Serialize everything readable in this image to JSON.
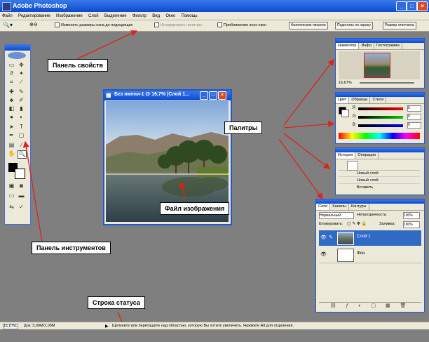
{
  "window": {
    "title": "Adobe Photoshop",
    "min": "_",
    "max": "□",
    "close": "×"
  },
  "menu": [
    "Файл",
    "Редактирование",
    "Изображение",
    "Слой",
    "Выделение",
    "Фильтр",
    "Вид",
    "Окно",
    "Помощь"
  ],
  "options": {
    "check1": "Изменить размеры окна до подходящих",
    "check2": "Игнорировать палитры",
    "check3": "Приближение всех окон",
    "btn1": "Фактические пиксели",
    "btn2": "Подогнать по экрану",
    "btn3": "Размер отпечатка"
  },
  "document": {
    "title": "Без имени-1 @ 16,7% (Слой 1..."
  },
  "navigator": {
    "tabs": [
      "Навигатор",
      "Инфо",
      "Гистограмма"
    ],
    "zoom": "16,67%"
  },
  "color": {
    "tabs": [
      "Цвет",
      "Образцы",
      "Стили"
    ],
    "channels": [
      "R",
      "G",
      "B"
    ],
    "values": [
      "0",
      "0",
      "0"
    ]
  },
  "history": {
    "tabs": [
      "История",
      "Операции"
    ],
    "items": [
      "Новый слой",
      "Новый слой",
      "Вставить"
    ]
  },
  "layers": {
    "tabs": [
      "Слои",
      "Каналы",
      "Контуры"
    ],
    "mode": "Нормальный",
    "opacity_label": "Непрозрачность:",
    "opacity_value": "100%",
    "lock_label": "Блокировать:",
    "fill_label": "Заливка:",
    "fill_value": "100%",
    "rows": [
      "Слой 1",
      "Фон"
    ]
  },
  "labels": {
    "options_bar": "Панель свойств",
    "toolbox": "Панель инструментов",
    "palettes": "Палитры",
    "image_file": "Файл изображения",
    "status_bar": "Строка статуса"
  },
  "status": {
    "zoom": "16,67%",
    "doc": "Док: 3,00M/2,00M",
    "hint": "Щелкните или перетащите над областью, которую Вы хотите увеличить. Нажмите Alt для отдаления."
  },
  "colors": {
    "xp_blue": "#0a4bd0",
    "arrow": "#e0201e",
    "workspace": "#7f7f7f"
  }
}
